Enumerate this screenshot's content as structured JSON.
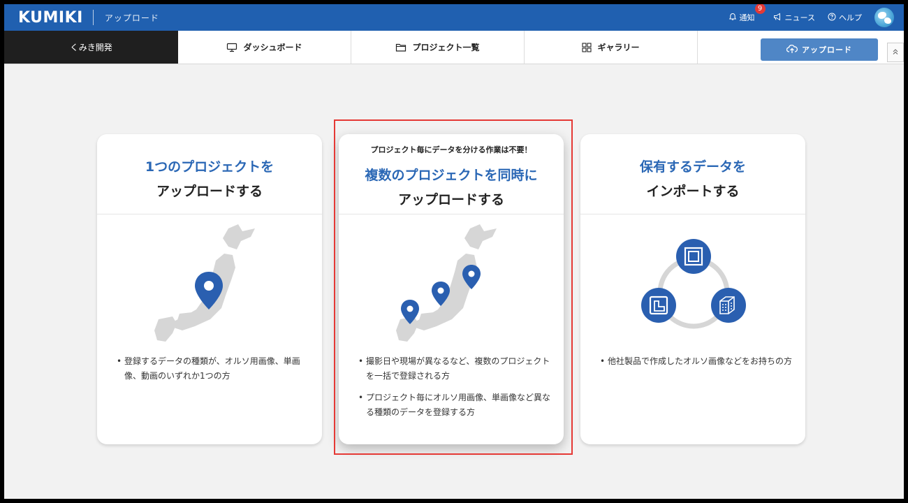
{
  "header": {
    "logo": "KUMIKI",
    "page_name": "アップロード",
    "notifications_label": "通知",
    "notifications_count": "9",
    "news_label": "ニュース",
    "help_label": "ヘルプ"
  },
  "nav": {
    "brand": "くみき開発",
    "tabs": [
      {
        "label": "ダッシュボード",
        "icon": "monitor-icon"
      },
      {
        "label": "プロジェクト一覧",
        "icon": "folder-icon"
      },
      {
        "label": "ギャラリー",
        "icon": "grid-icon"
      }
    ],
    "upload_label": "アップロード",
    "collapse_icon": "chevron-double-up-icon"
  },
  "cards": [
    {
      "title_line1": "1つのプロジェクトを",
      "title_line2": "アップロードする",
      "bullets": [
        "登録するデータの種類が、オルソ用画像、単画像、動画のいずれか1つの方"
      ]
    },
    {
      "pre": "プロジェクト毎にデータを分ける作業は不要！",
      "title_line1": "複数のプロジェクトを同時に",
      "title_line2": "アップロードする",
      "bullets": [
        "撮影日や現場が異なるなど、複数のプロジェクトを一括で登録される方",
        "プロジェクト毎にオルソ用画像、単画像など異なる種類のデータを登録する方"
      ]
    },
    {
      "title_line1": "保有するデータを",
      "title_line2": "インポートする",
      "bullets": [
        "他社製品で作成したオルソ画像などをお持ちの方"
      ]
    }
  ],
  "colors": {
    "header_bg": "#2060b0",
    "accent": "#2a67b5",
    "highlight": "#e53935"
  }
}
